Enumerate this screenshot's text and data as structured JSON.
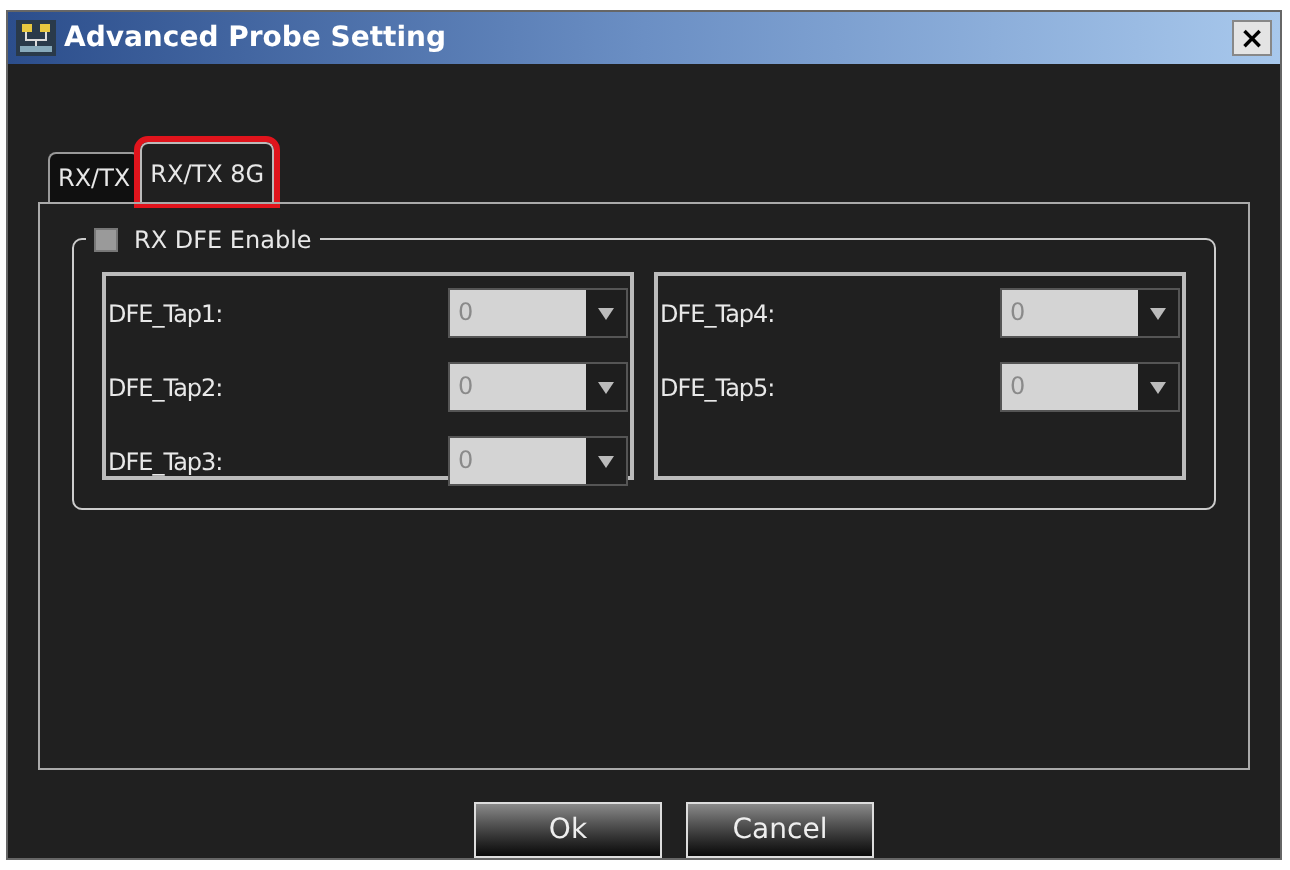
{
  "window": {
    "title": "Advanced Probe Setting",
    "close": "×"
  },
  "tabs": [
    {
      "label": "RX/TX",
      "selected": false,
      "highlighted": false
    },
    {
      "label": "RX/TX 8G",
      "selected": true,
      "highlighted": true
    }
  ],
  "group": {
    "label": "RX DFE Enable",
    "checked": false
  },
  "columns": [
    [
      {
        "label": "DFE_Tap1:",
        "value": "0"
      },
      {
        "label": "DFE_Tap2:",
        "value": "0"
      },
      {
        "label": "DFE_Tap3:",
        "value": "0"
      }
    ],
    [
      {
        "label": "DFE_Tap4:",
        "value": "0"
      },
      {
        "label": "DFE_Tap5:",
        "value": "0"
      }
    ]
  ],
  "buttons": [
    "Ok",
    "Cancel"
  ]
}
